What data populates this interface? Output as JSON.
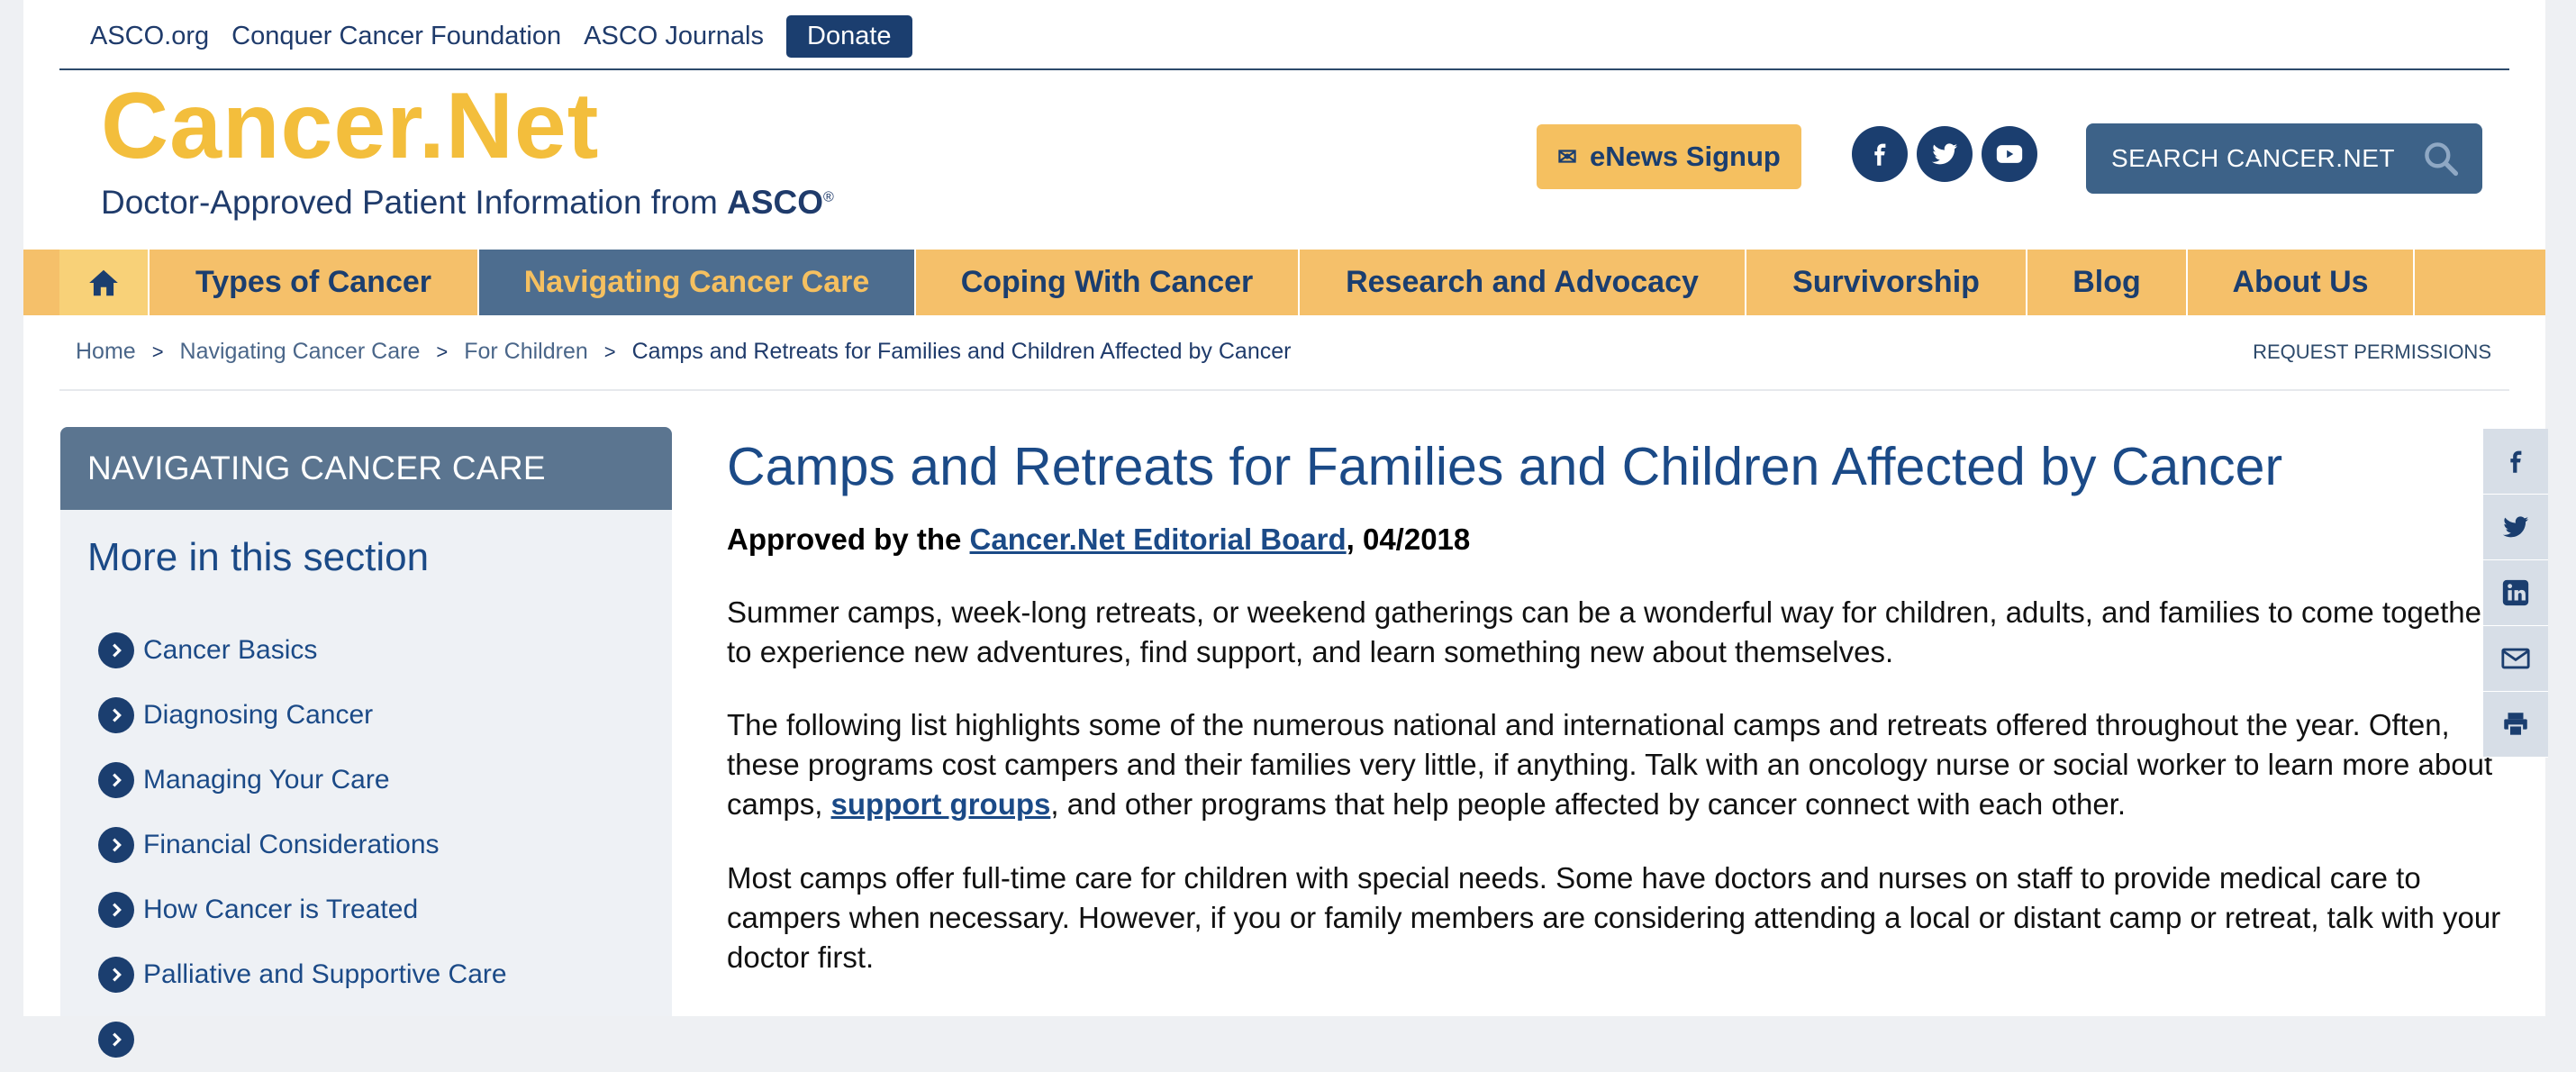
{
  "util": {
    "links": [
      "ASCO.org",
      "Conquer Cancer Foundation",
      "ASCO Journals"
    ],
    "donate": "Donate"
  },
  "logo": {
    "brand": "Cancer.Net",
    "tagline": "Doctor-Approved Patient Information from ",
    "tagline_strong": "ASCO",
    "reg": "®"
  },
  "header": {
    "enews": "eNews Signup",
    "search": "SEARCH CANCER.NET",
    "social": [
      "facebook-icon",
      "twitter-icon",
      "youtube-icon"
    ]
  },
  "nav": {
    "items": [
      "Types of Cancer",
      "Navigating Cancer Care",
      "Coping With Cancer",
      "Research and Advocacy",
      "Survivorship",
      "Blog",
      "About Us"
    ],
    "active": "Navigating Cancer Care"
  },
  "breadcrumb": {
    "items": [
      "Home",
      "Navigating Cancer Care",
      "For Children"
    ],
    "current": "Camps and Retreats for Families and Children Affected by Cancer",
    "request": "REQUEST PERMISSIONS"
  },
  "sidebar": {
    "heading": "NAVIGATING CANCER CARE",
    "subheading": "More in this section",
    "items": [
      "Cancer Basics",
      "Diagnosing Cancer",
      "Managing Your Care",
      "Financial Considerations",
      "How Cancer is Treated",
      "Palliative and Supportive Care"
    ]
  },
  "article": {
    "title": "Camps and Retreats for Families and Children Affected by Cancer",
    "approved_prefix": "Approved by the ",
    "approved_link": "Cancer.Net Editorial Board",
    "approved_suffix": ", 04/2018",
    "p1": "Summer camps, week-long retreats, or weekend gatherings can be a wonderful way for children, adults, and families to come together to experience new adventures, find support, and learn something new about themselves.",
    "p2_a": "The following list highlights some of the numerous national and international camps and retreats offered throughout the year. Often, these programs cost campers and their families very little, if anything. Talk with an oncology nurse or social worker to learn more about camps, ",
    "p2_link": "support groups",
    "p2_b": ", and other programs that help people affected by cancer connect with each other.",
    "p3": "Most camps offer full-time care for children with special needs. Some have doctors and nurses on staff to provide medical care to campers when necessary. However, if you or family members are considering attending a local or distant camp or retreat, talk with your doctor first."
  },
  "share": [
    "facebook-share-icon",
    "twitter-share-icon",
    "linkedin-share-icon",
    "email-share-icon",
    "print-icon"
  ],
  "colors": {
    "navy": "#1b3e6f",
    "gold": "#f3be3c",
    "nav_bg": "#f5c06a",
    "active_nav": "#4d6d8f"
  }
}
